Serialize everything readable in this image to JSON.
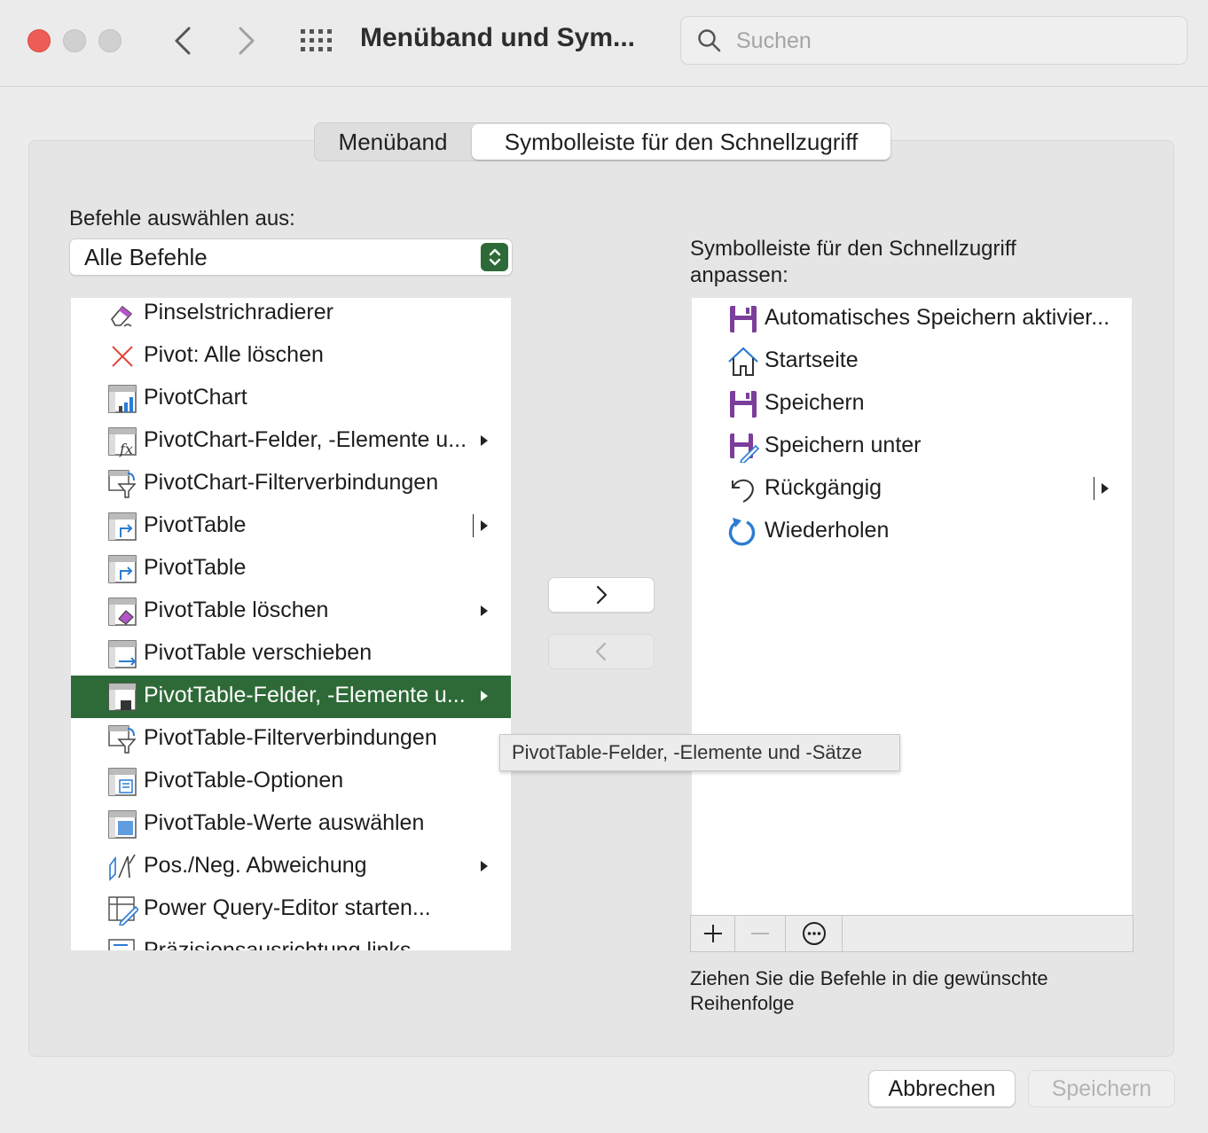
{
  "window": {
    "title": "Menüband und Sym...",
    "search_placeholder": "Suchen"
  },
  "tabs": [
    {
      "label": "Menüband",
      "active": false
    },
    {
      "label": "Symbolleiste für den Schnellzugriff",
      "active": true
    }
  ],
  "left": {
    "heading": "Befehle auswählen aus:",
    "dropdown_value": "Alle Befehle",
    "items": [
      {
        "label": "Pinselstrichradierer",
        "icon": "eraser-icon",
        "submenu": false
      },
      {
        "label": "Pivot: Alle löschen",
        "icon": "red-x-icon",
        "submenu": false
      },
      {
        "label": "PivotChart",
        "icon": "pivotchart-icon",
        "submenu": false
      },
      {
        "label": "PivotChart-Felder, -Elemente u...",
        "icon": "pivot-fx-icon",
        "submenu": true
      },
      {
        "label": "PivotChart-Filterverbindungen",
        "icon": "pivot-filter-icon",
        "submenu": false
      },
      {
        "label": "PivotTable",
        "icon": "pivottable-icon",
        "submenu": true,
        "split": true
      },
      {
        "label": "PivotTable",
        "icon": "pivottable-icon",
        "submenu": false
      },
      {
        "label": "PivotTable löschen",
        "icon": "pivottable-clear-icon",
        "submenu": true
      },
      {
        "label": "PivotTable verschieben",
        "icon": "pivottable-move-icon",
        "submenu": false
      },
      {
        "label": "PivotTable-Felder, -Elemente u...",
        "icon": "pivottable-fields-icon",
        "submenu": true,
        "selected": true
      },
      {
        "label": "PivotTable-Filterverbindungen",
        "icon": "pivot-filter-icon",
        "submenu": false
      },
      {
        "label": "PivotTable-Optionen",
        "icon": "pivottable-options-icon",
        "submenu": false
      },
      {
        "label": "PivotTable-Werte auswählen",
        "icon": "pivottable-values-icon",
        "submenu": false
      },
      {
        "label": "Pos./Neg. Abweichung",
        "icon": "deviation-icon",
        "submenu": true
      },
      {
        "label": "Power Query-Editor starten...",
        "icon": "power-query-icon",
        "submenu": false
      },
      {
        "label": "Präzisionsausrichtung links",
        "icon": "align-icon",
        "submenu": false
      }
    ]
  },
  "tooltip": "PivotTable-Felder, -Elemente und -Sätze",
  "right": {
    "heading": "Symbolleiste für den Schnellzugriff anpassen:",
    "items": [
      {
        "label": "Automatisches Speichern aktivier...",
        "icon": "save-purple-icon",
        "submenu": false
      },
      {
        "label": "Startseite",
        "icon": "home-icon",
        "submenu": false
      },
      {
        "label": "Speichern",
        "icon": "save-purple-icon",
        "submenu": false
      },
      {
        "label": "Speichern unter",
        "icon": "save-as-icon",
        "submenu": false
      },
      {
        "label": "Rückgängig",
        "icon": "undo-icon",
        "submenu": true,
        "split": true
      },
      {
        "label": "Wiederholen",
        "icon": "redo-icon",
        "submenu": false
      }
    ],
    "hint": "Ziehen Sie die Befehle in die gewünschte Reihenfolge"
  },
  "footer": {
    "cancel_label": "Abbrechen",
    "save_label": "Speichern"
  },
  "colors": {
    "accent_green": "#2e6a37",
    "close_red": "#ee5d55",
    "office_purple": "#7b3e9b",
    "office_blue": "#2b7cd3"
  }
}
